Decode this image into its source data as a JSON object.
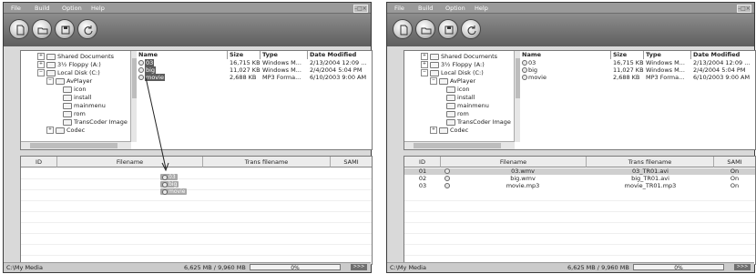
{
  "menu": [
    "File",
    "Build",
    "Option",
    "Help"
  ],
  "winbuttons_text": "–□×",
  "toolbar_icons": [
    "new-icon",
    "folder-icon",
    "save-icon",
    "refresh-icon"
  ],
  "tree": [
    {
      "label": "Shared Documents",
      "toggle": "+"
    },
    {
      "label": "3½ Floppy (A:)",
      "toggle": "+"
    },
    {
      "label": "Local Disk (C:)",
      "toggle": "−"
    },
    {
      "label": "AvPlayer",
      "toggle": "−"
    },
    {
      "label": "icon",
      "toggle": ""
    },
    {
      "label": "install",
      "toggle": ""
    },
    {
      "label": "mainmenu",
      "toggle": ""
    },
    {
      "label": "rom",
      "toggle": ""
    },
    {
      "label": "TransCoder Image",
      "toggle": ""
    },
    {
      "label": "Codec",
      "toggle": "+"
    }
  ],
  "files": {
    "headers": {
      "name": "Name",
      "size": "Size",
      "type": "Type",
      "modified": "Date Modified"
    },
    "rows": [
      {
        "name": "03",
        "size": "16,715 KB",
        "type": "Windows M...",
        "modified": "2/13/2004 12:09 ..."
      },
      {
        "name": "big",
        "size": "11,027 KB",
        "type": "Windows M...",
        "modified": "2/4/2004 5:04 PM"
      },
      {
        "name": "movie",
        "size": "2,688 KB",
        "type": "MP3 Forma...",
        "modified": "6/10/2003 9:00 AM"
      }
    ]
  },
  "trans": {
    "headers": {
      "id": "ID",
      "filename": "Filename",
      "trans": "Trans filename",
      "sami": "SAMI"
    },
    "rows": [
      {
        "id": "01",
        "filename": "03.wmv",
        "trans": "03_TR01.avi",
        "sami": "On"
      },
      {
        "id": "02",
        "filename": "big.wmv",
        "trans": "big_TR01.avi",
        "sami": "On"
      },
      {
        "id": "03",
        "filename": "movie.mp3",
        "trans": "movie_TR01.mp3",
        "sami": "On"
      }
    ]
  },
  "drag_items": [
    "03",
    "big",
    "movie"
  ],
  "status": {
    "path": "C:\\My Media",
    "size": "6,625 MB / 9,960 MB",
    "progress": "0%",
    "progress_value": 0,
    "go_label": ">>>"
  },
  "colors": {
    "toolbar_dark": "#5e5e5e",
    "selection": "#5c5c5c",
    "trans_selected_row": "#cfcfcf"
  }
}
